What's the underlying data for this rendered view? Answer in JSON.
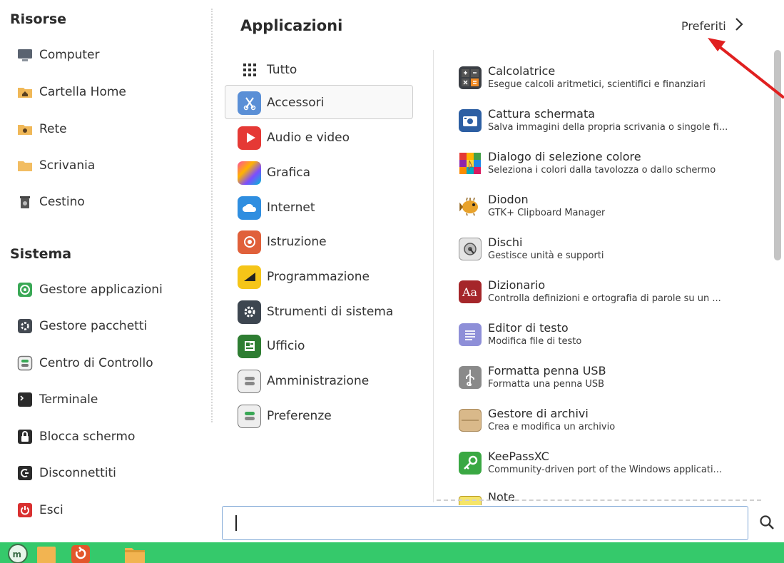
{
  "places": {
    "title": "Risorse",
    "items": [
      {
        "label": "Computer",
        "icon": "computer-icon"
      },
      {
        "label": "Cartella Home",
        "icon": "home-folder-icon"
      },
      {
        "label": "Rete",
        "icon": "network-folder-icon"
      },
      {
        "label": "Scrivania",
        "icon": "desktop-folder-icon"
      },
      {
        "label": "Cestino",
        "icon": "trash-icon"
      }
    ]
  },
  "system": {
    "title": "Sistema",
    "items": [
      {
        "label": "Gestore applicazioni",
        "icon": "software-manager-icon"
      },
      {
        "label": "Gestore pacchetti",
        "icon": "package-manager-icon"
      },
      {
        "label": "Centro di Controllo",
        "icon": "control-center-icon"
      },
      {
        "label": "Terminale",
        "icon": "terminal-icon"
      },
      {
        "label": "Blocca schermo",
        "icon": "lock-icon"
      },
      {
        "label": "Disconnettiti",
        "icon": "logout-icon"
      },
      {
        "label": "Esci",
        "icon": "power-icon"
      }
    ]
  },
  "header": {
    "title": "Applicazioni",
    "favorites_label": "Preferiti",
    "favorites_icon": "chevron-right-icon"
  },
  "categories": {
    "selected": "Accessori",
    "items": [
      {
        "label": "Tutto",
        "icon": "grid-icon"
      },
      {
        "label": "Accessori",
        "icon": "accessories-icon"
      },
      {
        "label": "Audio e video",
        "icon": "multimedia-icon"
      },
      {
        "label": "Grafica",
        "icon": "graphics-icon"
      },
      {
        "label": "Internet",
        "icon": "internet-icon"
      },
      {
        "label": "Istruzione",
        "icon": "education-icon"
      },
      {
        "label": "Programmazione",
        "icon": "development-icon"
      },
      {
        "label": "Strumenti di sistema",
        "icon": "system-tools-icon"
      },
      {
        "label": "Ufficio",
        "icon": "office-icon"
      },
      {
        "label": "Amministrazione",
        "icon": "administration-icon"
      },
      {
        "label": "Preferenze",
        "icon": "preferences-icon"
      }
    ]
  },
  "apps": [
    {
      "name": "Calcolatrice",
      "desc": "Esegue calcoli aritmetici, scientifici e finanziari",
      "icon": "calculator-icon"
    },
    {
      "name": "Cattura schermata",
      "desc": "Salva immagini della propria scrivania o singole fi...",
      "icon": "screenshot-icon"
    },
    {
      "name": "Dialogo di selezione colore",
      "desc": "Seleziona i colori dalla tavolozza o dallo schermo",
      "icon": "color-picker-icon"
    },
    {
      "name": "Diodon",
      "desc": "GTK+ Clipboard Manager",
      "icon": "diodon-icon"
    },
    {
      "name": "Dischi",
      "desc": "Gestisce unità e supporti",
      "icon": "disks-icon"
    },
    {
      "name": "Dizionario",
      "desc": "Controlla definizioni e ortografia di parole su un ...",
      "icon": "dictionary-icon"
    },
    {
      "name": "Editor di testo",
      "desc": "Modifica file di testo",
      "icon": "text-editor-icon"
    },
    {
      "name": "Formatta penna USB",
      "desc": "Formatta una penna USB",
      "icon": "usb-icon"
    },
    {
      "name": "Gestore di archivi",
      "desc": "Crea e modifica un archivio",
      "icon": "archive-icon"
    },
    {
      "name": "KeePassXC",
      "desc": "Community-driven port of the Windows applicati...",
      "icon": "keepassxc-icon"
    },
    {
      "name": "Note",
      "desc": "",
      "icon": "notes-icon"
    }
  ],
  "search": {
    "placeholder": "",
    "icon": "search-icon"
  },
  "panel": {
    "color": "#35c96b",
    "items": [
      "mint-menu-icon",
      "files-icon",
      "update-manager-icon",
      "folder-icon"
    ]
  },
  "colors": {
    "accent": "#35c96b",
    "annotation_arrow": "#e02020"
  }
}
